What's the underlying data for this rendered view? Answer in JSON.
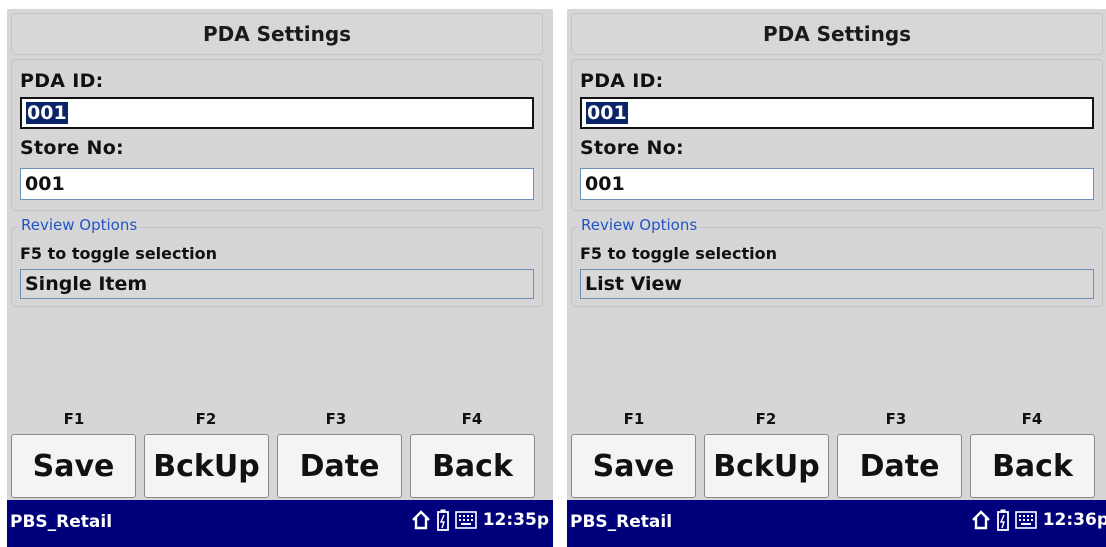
{
  "screens": [
    {
      "title": "PDA Settings",
      "pda_id_label": "PDA ID:",
      "pda_id_value": "001",
      "store_label": "Store No:",
      "store_value": "001",
      "review_legend": "Review Options",
      "toggle_hint": "F5 to toggle selection",
      "review_value": "Single Item",
      "fkeys": [
        "F1",
        "F2",
        "F3",
        "F4"
      ],
      "buttons": [
        "Save",
        "BckUp",
        "Date",
        "Back"
      ],
      "app_name": "PBS_Retail",
      "time": "12:35p"
    },
    {
      "title": "PDA Settings",
      "pda_id_label": "PDA ID:",
      "pda_id_value": "001",
      "store_label": "Store No:",
      "store_value": "001",
      "review_legend": "Review Options",
      "toggle_hint": "F5 to toggle selection",
      "review_value": "List View",
      "fkeys": [
        "F1",
        "F2",
        "F3",
        "F4"
      ],
      "buttons": [
        "Save",
        "BckUp",
        "Date",
        "Back"
      ],
      "app_name": "PBS_Retail",
      "time": "12:36p"
    }
  ],
  "icons": [
    "home-icon",
    "battery-icon",
    "keyboard-icon"
  ],
  "colors": {
    "taskbar": "#00007a",
    "legend": "#2155c8",
    "selection": "#0a246a"
  }
}
